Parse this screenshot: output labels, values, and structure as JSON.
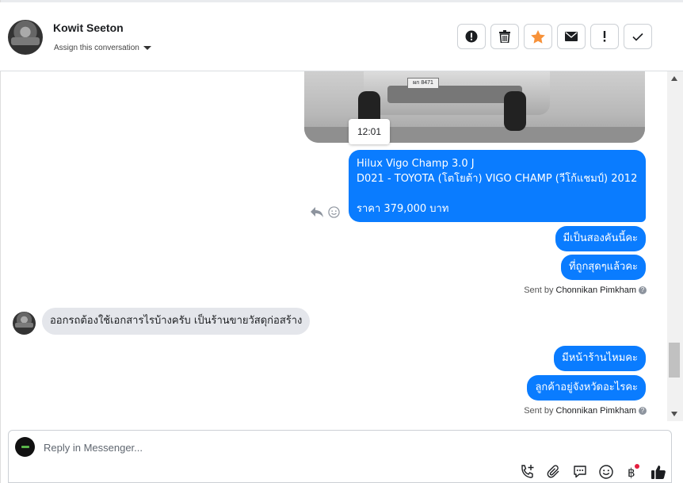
{
  "header": {
    "contact_name": "Kowit Seeton",
    "assign_label": "Assign this conversation",
    "actions": [
      {
        "name": "spam",
        "icon": "exclamation-circle-icon"
      },
      {
        "name": "delete",
        "icon": "trash-icon"
      },
      {
        "name": "star",
        "icon": "star-icon"
      },
      {
        "name": "mark-unread",
        "icon": "envelope-icon"
      },
      {
        "name": "follow-up",
        "icon": "exclamation-icon"
      },
      {
        "name": "done",
        "icon": "check-icon"
      }
    ],
    "star_color": "#f7923a"
  },
  "conversation": {
    "image_time": "12:01",
    "car_plate": "ผก 8471",
    "outgoing_block_1": {
      "line1": "Hilux Vigo Champ 3.0 J",
      "line2": "D021 - TOYOTA (โตโยต้า) VIGO CHAMP (วีโก้แชมป์) 2012",
      "line3": "ราคา 379,000 บาท"
    },
    "outgoing_msg_2": "มีเป็นสองคันนี้คะ",
    "outgoing_msg_3": "ที่ถูกสุดๆแล้วคะ",
    "sent_by_1": {
      "prefix": "Sent by",
      "name": "Chonnikan Pimkham"
    },
    "incoming_msg": "ออกรถต้องใช้เอกสารไรบ้างครับ เป็นร้านขายวัสดุก่อสร้าง",
    "outgoing_msg_4": "มีหน้าร้านไหมคะ",
    "outgoing_msg_5": "ลูกค้าอยู่จังหวัดอะไรคะ",
    "sent_by_2": {
      "prefix": "Sent by",
      "name": "Chonnikan Pimkham"
    },
    "bubble_color": "#0a7cff"
  },
  "composer": {
    "placeholder": "Reply in Messenger...",
    "tools": [
      "phone-add-icon",
      "paperclip-icon",
      "saved-reply-icon",
      "emoji-icon",
      "baht-payment-icon",
      "thumbs-up-icon"
    ]
  }
}
